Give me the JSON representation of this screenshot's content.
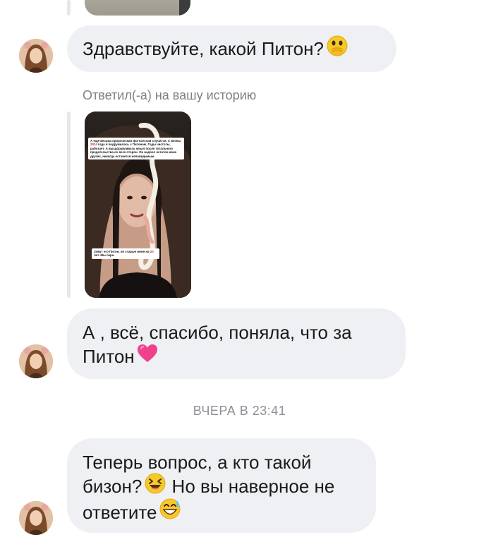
{
  "conversation": {
    "messages": [
      {
        "lines": [
          "Здравствуйте,  какой Питон?"
        ],
        "emoji": "face-with-hand-over-mouth"
      },
      {
        "lines": [
          "А , всё,  спасибо,  поняла, что за",
          "Питон"
        ],
        "emoji": "pink-heart"
      },
      {
        "lines": [
          "Теперь вопрос, а кто такой",
          "бизон?",
          " Но вы наверное не",
          "ответите"
        ],
        "emoji_1": "laughing-face",
        "emoji_2": "grinning-sweat-face"
      }
    ],
    "reply_caption": "Ответил(-а) на вашу историю",
    "timestamp": "ВЧЕРА В 23:41",
    "story": {
      "top_note": {
        "part1": "А ещё весьма пророческая фотосессия случится. С весны ",
        "highlight": "2024",
        "part2": " года я подружилась с Питоном. Годы чистоты, работает. А выздоравливать начал после тотального предательства со всех сторон. Он надоел остаток моих других, никогда останется неповидимым."
      },
      "bottom_note": {
        "part1": "Зовут его Питон, он старше меня на ",
        "highlight": "20",
        "part2": " лет. Мы пара."
      }
    }
  },
  "colors": {
    "bubble_bg": "#eff0f4",
    "text": "#1a1a1a",
    "meta_text": "#7c7f86",
    "heart": "#f0418c",
    "emoji_yellow": "#f7c928"
  }
}
